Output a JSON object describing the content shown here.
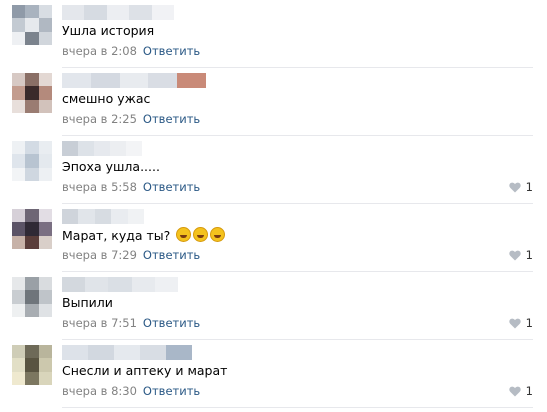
{
  "colors": {
    "link": "#2a5885",
    "meta": "#828282",
    "divider": "#e7e8ec",
    "like_icon": "#b6bcc4",
    "emoji": "#f4c21d"
  },
  "comments": [
    {
      "text": "Ушла история",
      "time": "вчера в 2:08",
      "reply": "Ответить",
      "likes": "",
      "avatar": [
        "#8f9aa8",
        "#a9b3bf",
        "#d8dde3",
        "#c3cad2",
        "#e6e9ed",
        "#b0b8c2",
        "#eef0f3",
        "#7b838d",
        "#d1d6dc"
      ],
      "author": [
        "#e4e7ec",
        "#d6dbe2",
        "#eceef2",
        "#dde1e7",
        "#f1f2f5"
      ]
    },
    {
      "text": "смешно ужас",
      "time": "вчера в 2:25",
      "reply": "Ответить",
      "likes": "",
      "avatar": [
        "#d7c9c4",
        "#8a6f66",
        "#e3d8d3",
        "#c39c8e",
        "#3b2a2a",
        "#b48a7c",
        "#e8dfdb",
        "#9a7c72",
        "#d2c2bb"
      ],
      "author": [
        "#e2e6ec",
        "#d4d9e1",
        "#e8ebef",
        "#d9dde4",
        "#c98a78"
      ]
    },
    {
      "text": "Эпоха ушла.....",
      "time": "вчера в 5:58",
      "reply": "Ответить",
      "likes": "1",
      "avatar": [
        "#eef1f4",
        "#d3dbe4",
        "#e9edf1",
        "#dfe5ec",
        "#b8c4d1",
        "#e4e9ee",
        "#f2f4f6",
        "#cfd7e0",
        "#edf0f3"
      ],
      "author": [
        "#c8ced6",
        "#dde2e8",
        "#e6e9ee",
        "#eceef1",
        "#f3f4f6"
      ]
    },
    {
      "text": "Марат, куда ты?",
      "time": "вчера в 7:29",
      "reply": "Ответить",
      "likes": "1",
      "avatar": [
        "#d6d0d8",
        "#6e6675",
        "#e2dde4",
        "#5b5366",
        "#2f2935",
        "#7a6f82",
        "#c7b2a8",
        "#5a3d3a",
        "#d9cfc9"
      ],
      "author": [
        "#cfd4db",
        "#e1e5ea",
        "#d7dce2",
        "#e9ecf0",
        "#f0f2f4"
      ]
    },
    {
      "text": "Выпили",
      "time": "вчера в 7:51",
      "reply": "Ответить",
      "likes": "1",
      "avatar": [
        "#e6e8ea",
        "#9aa0a6",
        "#d9dcdf",
        "#c9cdd1",
        "#6f757b",
        "#bfc4c9",
        "#eef0f1",
        "#a8adb2",
        "#dfe2e5"
      ],
      "author": [
        "#d3d8de",
        "#e0e4e9",
        "#dadfe5",
        "#e7eaee",
        "#eef0f3"
      ]
    },
    {
      "text": "Снесли и аптеку и марат",
      "time": "вчера в 8:30",
      "reply": "Ответить",
      "likes": "1",
      "avatar": [
        "#cfcdb7",
        "#6e6a58",
        "#b9b59c",
        "#e2dfc6",
        "#595441",
        "#ccc8ad",
        "#efe9cf",
        "#7c7760",
        "#d9d5bb"
      ],
      "author": [
        "#dde2e9",
        "#d2d8e0",
        "#e5e9ee",
        "#d8dde4",
        "#a9b7c8"
      ]
    }
  ]
}
